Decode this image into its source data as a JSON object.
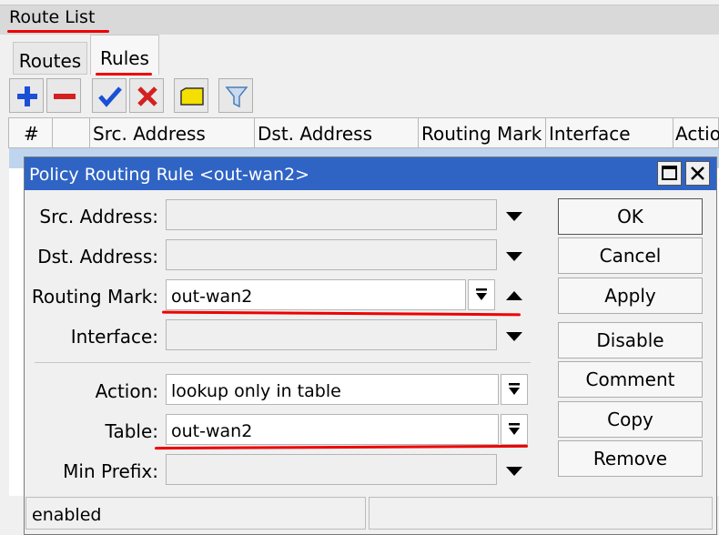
{
  "window": {
    "title": "Route List"
  },
  "tabs": [
    {
      "label": "Routes"
    },
    {
      "label": "Rules"
    }
  ],
  "toolbar": {
    "buttons": [
      {
        "icon": "plus-icon",
        "color": "#1a4fd6"
      },
      {
        "icon": "minus-icon",
        "color": "#d42020"
      },
      {
        "icon": "check-icon",
        "color": "#1a4fd6"
      },
      {
        "icon": "x-icon",
        "color": "#d42020"
      },
      {
        "icon": "comment-icon",
        "color": "#f4e000"
      },
      {
        "icon": "filter-icon",
        "color": "#4a7fb8"
      }
    ]
  },
  "table": {
    "columns": [
      "#",
      "",
      "Src. Address",
      "Dst. Address",
      "Routing Mark",
      "Interface",
      "Actio"
    ]
  },
  "dialog": {
    "title": "Policy Routing Rule <out-wan2>",
    "fields": {
      "src_address": {
        "label": "Src. Address:",
        "value": ""
      },
      "dst_address": {
        "label": "Dst. Address:",
        "value": ""
      },
      "routing_mark": {
        "label": "Routing Mark:",
        "value": "out-wan2"
      },
      "interface": {
        "label": "Interface:",
        "value": ""
      },
      "action": {
        "label": "Action:",
        "value": "lookup only in table"
      },
      "table": {
        "label": "Table:",
        "value": "out-wan2"
      },
      "min_prefix": {
        "label": "Min Prefix:",
        "value": ""
      }
    },
    "buttons": {
      "ok": "OK",
      "cancel": "Cancel",
      "apply": "Apply",
      "disable": "Disable",
      "comment": "Comment",
      "copy": "Copy",
      "remove": "Remove"
    },
    "status": "enabled"
  },
  "colors": {
    "title_bar": "#2f64c5",
    "annotation": "#ee0000",
    "selected_row": "#bfd5ee"
  }
}
